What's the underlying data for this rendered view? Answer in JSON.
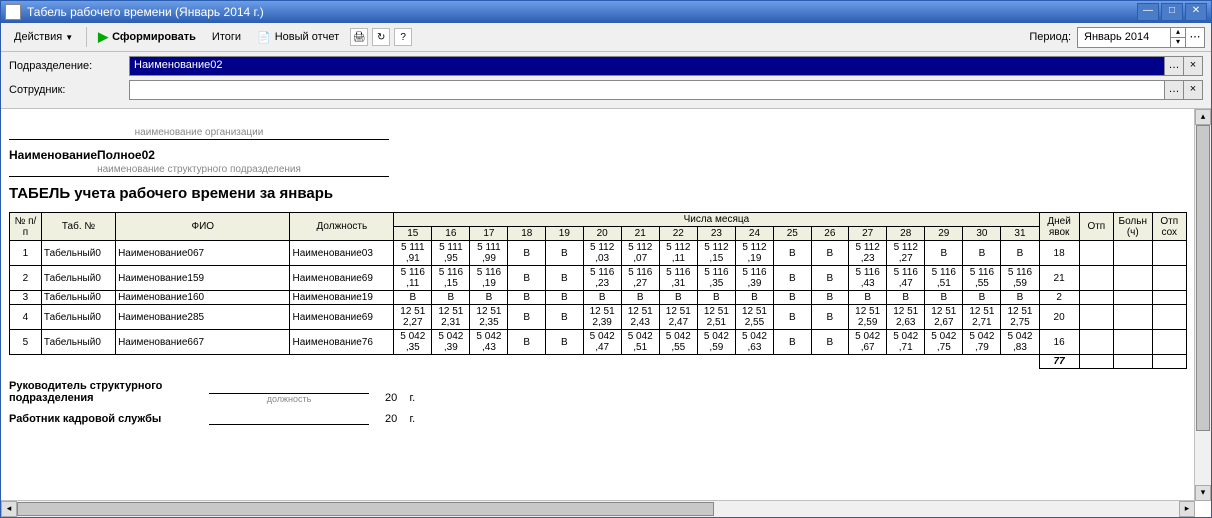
{
  "window": {
    "title": "Табель рабочего времени (Январь 2014 г.)"
  },
  "toolbar": {
    "actions": "Действия",
    "form": "Сформировать",
    "totals": "Итоги",
    "newreport": "Новый отчет",
    "period_label": "Период:",
    "period_value": "Январь 2014"
  },
  "filters": {
    "dept_label": "Подразделение:",
    "dept_value": "Наименование02",
    "emp_label": "Сотрудник:",
    "emp_value": ""
  },
  "report": {
    "orglabel": "наименование организации",
    "orgname": "НаименованиеПолное02",
    "deptlabel": "наименование структурного подразделения",
    "title": "ТАБЕЛЬ учета рабочего времени за январь",
    "head_num": "№ п/п",
    "head_tab": "Таб. №",
    "head_fio": "ФИО",
    "head_pos": "Должность",
    "head_days": "Числа месяца",
    "head_appear": "Дней явок",
    "head_otp": "Отп",
    "head_boln": "Больн (ч)",
    "head_otp2": "Отп сох",
    "sign1": "Руководитель структурного подразделения",
    "sign_small": "должность",
    "sign2": "Работник кадровой службы",
    "sign_year": "20",
    "sign_g": "г.",
    "days": [
      "15",
      "16",
      "17",
      "18",
      "19",
      "20",
      "21",
      "22",
      "23",
      "24",
      "25",
      "26",
      "27",
      "28",
      "29",
      "30",
      "31"
    ],
    "rows": [
      {
        "n": "1",
        "tab": "Табельный0",
        "fio": "Наименование067",
        "pos": "Наименование03",
        "cells": [
          "5 111 ,91",
          "5 111 ,95",
          "5 111 ,99",
          "В",
          "В",
          "5 112 ,03",
          "5 112 ,07",
          "5 112 ,11",
          "5 112 ,15",
          "5 112 ,19",
          "В",
          "В",
          "5 112 ,23",
          "5 112 ,27",
          "В",
          "В",
          "В"
        ],
        "appear": "18"
      },
      {
        "n": "2",
        "tab": "Табельный0",
        "fio": "Наименование159",
        "pos": "Наименование69",
        "cells": [
          "5 116 ,11",
          "5 116 ,15",
          "5 116 ,19",
          "В",
          "В",
          "5 116 ,23",
          "5 116 ,27",
          "5 116 ,31",
          "5 116 ,35",
          "5 116 ,39",
          "В",
          "В",
          "5 116 ,43",
          "5 116 ,47",
          "5 116 ,51",
          "5 116 ,55",
          "5 116 ,59"
        ],
        "appear": "21"
      },
      {
        "n": "3",
        "tab": "Табельный0",
        "fio": "Наименование160",
        "pos": "Наименование19",
        "cells": [
          "В",
          "В",
          "В",
          "В",
          "В",
          "В",
          "В",
          "В",
          "В",
          "В",
          "В",
          "В",
          "В",
          "В",
          "В",
          "В",
          "В"
        ],
        "appear": "2"
      },
      {
        "n": "4",
        "tab": "Табельный0",
        "fio": "Наименование285",
        "pos": "Наименование69",
        "cells": [
          "12 51 2,27",
          "12 51 2,31",
          "12 51 2,35",
          "В",
          "В",
          "12 51 2,39",
          "12 51 2,43",
          "12 51 2,47",
          "12 51 2,51",
          "12 51 2,55",
          "В",
          "В",
          "12 51 2,59",
          "12 51 2,63",
          "12 51 2,67",
          "12 51 2,71",
          "12 51 2,75"
        ],
        "appear": "20"
      },
      {
        "n": "5",
        "tab": "Табельный0",
        "fio": "Наименование667",
        "pos": "Наименование76",
        "cells": [
          "5 042 ,35",
          "5 042 ,39",
          "5 042 ,43",
          "В",
          "В",
          "5 042 ,47",
          "5 042 ,51",
          "5 042 ,55",
          "5 042 ,59",
          "5 042 ,63",
          "В",
          "В",
          "5 042 ,67",
          "5 042 ,71",
          "5 042 ,75",
          "5 042 ,79",
          "5 042 ,83"
        ],
        "appear": "16"
      }
    ],
    "total_appear": "77"
  }
}
